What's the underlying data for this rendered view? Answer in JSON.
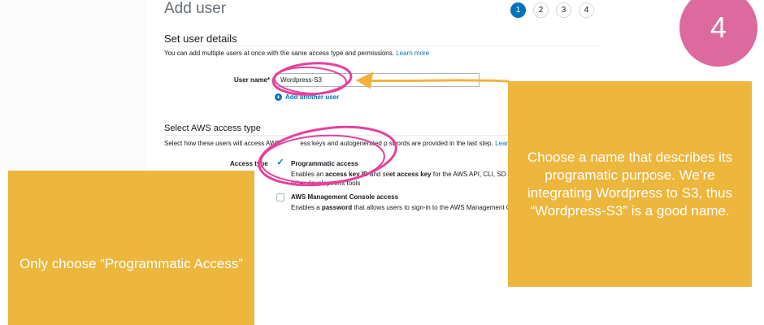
{
  "header": {
    "title": "Add user",
    "steps": [
      "1",
      "2",
      "3",
      "4"
    ]
  },
  "details": {
    "title": "Set user details",
    "description": "You can add multiple users at once with the same access type and permissions.",
    "learn_more": "Learn more",
    "username_label": "User name*",
    "username_value": "Wordpress-S3",
    "add_another": "Add another user"
  },
  "access": {
    "title": "Select AWS access type",
    "description": "Select how these users will access AWS",
    "description_hidden_1": "ess keys and autogenerated p",
    "description_hidden_2": "swords are provided in the last step.",
    "learn_more": "Learn",
    "label": "Access type",
    "options": [
      {
        "title": "Programmatic access",
        "desc_1": "Enables an",
        "desc_2": "access key ID",
        "desc_3": "and se",
        "desc_4": "et access key",
        "desc_5": "for the AWS API, CLI, SD",
        "desc_6": "other development tools",
        "checked": true
      },
      {
        "title": "AWS Management Console access",
        "desc_1": "Enables a",
        "desc_2": "password",
        "desc_3": "that allows users to sign-in to the AWS Management C",
        "checked": false
      }
    ]
  },
  "annotations": {
    "right_note": "Choose a name that describes its programatic purpose. We’re integrating Wordpress to S3, thus “Wordpress-S3” is a good name.",
    "left_note": "Only choose “Programmatic Access”",
    "step_number": "4"
  },
  "colors": {
    "note_bg": "#edb63d",
    "badge_bg": "#dc6a9f",
    "highlight_pink": "#e6419c",
    "aws_blue": "#0073bb",
    "arrow_yellow": "#f0b43c"
  }
}
